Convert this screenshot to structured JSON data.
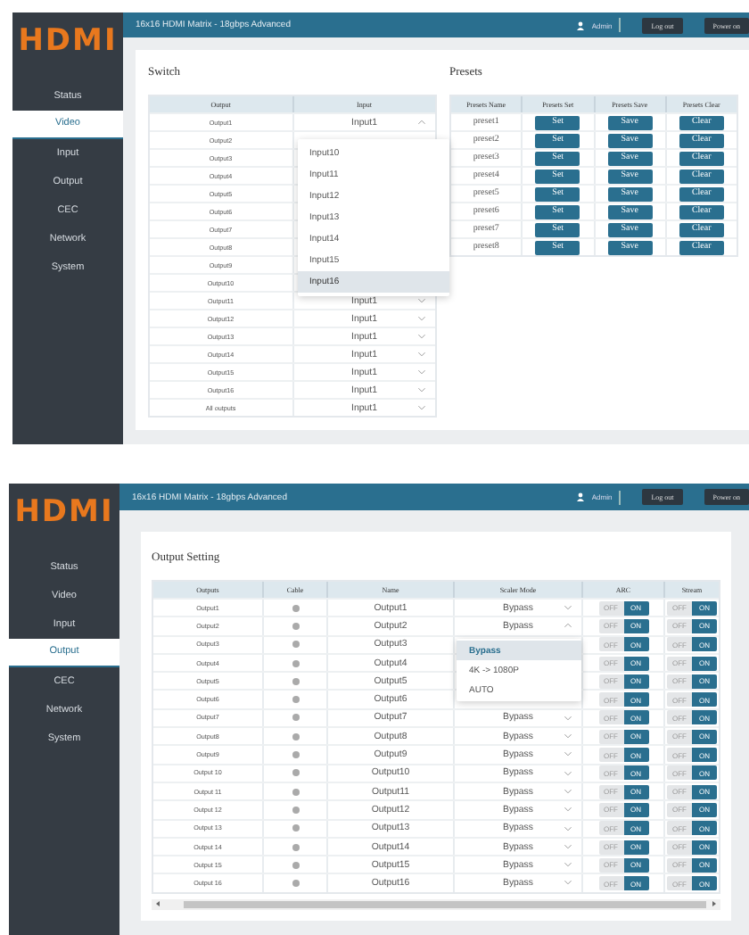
{
  "screens": [
    {
      "kind": "switch",
      "logo": "HDMI",
      "header": {
        "title": "16x16 HDMI Matrix - 18gbps Advanced",
        "user": "Admin",
        "logout": "Log out",
        "power": "Power on"
      },
      "nav": [
        {
          "label": "Status",
          "selected": false
        },
        {
          "label": "Video",
          "selected": true
        },
        {
          "label": "Input",
          "selected": false
        },
        {
          "label": "Output",
          "selected": false
        },
        {
          "label": "CEC",
          "selected": false
        },
        {
          "label": "Network",
          "selected": false
        },
        {
          "label": "System",
          "selected": false
        }
      ],
      "switch": {
        "title": "Switch",
        "columns": [
          "Output",
          "Input"
        ],
        "rows": [
          {
            "output": "Output1",
            "input": "Input1",
            "open": true
          },
          {
            "output": "Output2"
          },
          {
            "output": "Output3"
          },
          {
            "output": "Output4"
          },
          {
            "output": "Output5"
          },
          {
            "output": "Output6"
          },
          {
            "output": "Output7"
          },
          {
            "output": "Output8"
          },
          {
            "output": "Output9"
          },
          {
            "output": "Output10"
          },
          {
            "output": "Output11",
            "input": "Input1",
            "open": false
          },
          {
            "output": "Output12",
            "input": "Input1",
            "open": false
          },
          {
            "output": "Output13",
            "input": "Input1",
            "open": false
          },
          {
            "output": "Output14",
            "input": "Input1",
            "open": false
          },
          {
            "output": "Output15",
            "input": "Input1",
            "open": false
          },
          {
            "output": "Output16",
            "input": "Input1",
            "open": false
          },
          {
            "output": "All outputs",
            "input": "Input1",
            "open": false
          }
        ],
        "options": [
          {
            "label": "Input10",
            "selected": false
          },
          {
            "label": "Input11",
            "selected": false
          },
          {
            "label": "Input12",
            "selected": false
          },
          {
            "label": "Input13",
            "selected": false
          },
          {
            "label": "Input14",
            "selected": false
          },
          {
            "label": "Input15",
            "selected": false
          },
          {
            "label": "Input16",
            "selected": true
          }
        ]
      },
      "presets": {
        "title": "Presets",
        "columns": [
          "Presets Name",
          "Presets Set",
          "Presets Save",
          "Presets Clear"
        ],
        "rows": [
          {
            "name": "preset1",
            "set": "Set",
            "save": "Save",
            "clear": "Clear"
          },
          {
            "name": "preset2",
            "set": "Set",
            "save": "Save",
            "clear": "Clear"
          },
          {
            "name": "preset3",
            "set": "Set",
            "save": "Save",
            "clear": "Clear"
          },
          {
            "name": "preset4",
            "set": "Set",
            "save": "Save",
            "clear": "Clear"
          },
          {
            "name": "preset5",
            "set": "Set",
            "save": "Save",
            "clear": "Clear"
          },
          {
            "name": "preset6",
            "set": "Set",
            "save": "Save",
            "clear": "Clear"
          },
          {
            "name": "preset7",
            "set": "Set",
            "save": "Save",
            "clear": "Clear"
          },
          {
            "name": "preset8",
            "set": "Set",
            "save": "Save",
            "clear": "Clear"
          }
        ]
      }
    },
    {
      "kind": "output_setting",
      "logo": "HDMI",
      "header": {
        "title": "16x16 HDMI Matrix - 18gbps Advanced",
        "user": "Admin",
        "logout": "Log out",
        "power": "Power on"
      },
      "nav": [
        {
          "label": "Status",
          "selected": false
        },
        {
          "label": "Video",
          "selected": false
        },
        {
          "label": "Input",
          "selected": false
        },
        {
          "label": "Output",
          "selected": true
        },
        {
          "label": "CEC",
          "selected": false
        },
        {
          "label": "Network",
          "selected": false
        },
        {
          "label": "System",
          "selected": false
        }
      ],
      "output_setting": {
        "title": "Output Setting",
        "columns": [
          "Outputs",
          "Cable",
          "Name",
          "Scaler Mode",
          "ARC",
          "Stream"
        ],
        "rows": [
          {
            "output": "Output1",
            "name": "Output1",
            "mode": "Bypass",
            "open": false,
            "arc": {
              "labels": [
                "OFF",
                "ON"
              ],
              "on": true
            },
            "stream": {
              "labels": [
                "OFF",
                "ON"
              ],
              "on": true
            }
          },
          {
            "output": "Output2",
            "name": "Output2",
            "mode": "Bypass",
            "open": true,
            "arc": {
              "labels": [
                "OFF",
                "ON"
              ],
              "on": true
            },
            "stream": {
              "labels": [
                "OFF",
                "ON"
              ],
              "on": true
            }
          },
          {
            "output": "Output3",
            "name": "Output3",
            "arc": {
              "labels": [
                "OFF",
                "ON"
              ],
              "on": true
            },
            "stream": {
              "labels": [
                "OFF",
                "ON"
              ],
              "on": true
            }
          },
          {
            "output": "Output4",
            "name": "Output4",
            "arc": {
              "labels": [
                "OFF",
                "ON"
              ],
              "on": true
            },
            "stream": {
              "labels": [
                "OFF",
                "ON"
              ],
              "on": true
            }
          },
          {
            "output": "Output5",
            "name": "Output5",
            "arc": {
              "labels": [
                "OFF",
                "ON"
              ],
              "on": true
            },
            "stream": {
              "labels": [
                "OFF",
                "ON"
              ],
              "on": true
            }
          },
          {
            "output": "Output6",
            "name": "Output6",
            "arc": {
              "labels": [
                "OFF",
                "ON"
              ],
              "on": true
            },
            "stream": {
              "labels": [
                "OFF",
                "ON"
              ],
              "on": true
            }
          },
          {
            "output": "Output7",
            "name": "Output7",
            "mode": "Bypass",
            "open": false,
            "arc": {
              "labels": [
                "OFF",
                "ON"
              ],
              "on": true
            },
            "stream": {
              "labels": [
                "OFF",
                "ON"
              ],
              "on": true
            }
          },
          {
            "output": "Output8",
            "name": "Output8",
            "mode": "Bypass",
            "open": false,
            "arc": {
              "labels": [
                "OFF",
                "ON"
              ],
              "on": true
            },
            "stream": {
              "labels": [
                "OFF",
                "ON"
              ],
              "on": true
            }
          },
          {
            "output": "Output9",
            "name": "Output9",
            "mode": "Bypass",
            "open": false,
            "arc": {
              "labels": [
                "OFF",
                "ON"
              ],
              "on": true
            },
            "stream": {
              "labels": [
                "OFF",
                "ON"
              ],
              "on": true
            }
          },
          {
            "output": "Output 10",
            "name": "Output10",
            "mode": "Bypass",
            "open": false,
            "arc": {
              "labels": [
                "OFF",
                "ON"
              ],
              "on": true
            },
            "stream": {
              "labels": [
                "OFF",
                "ON"
              ],
              "on": true
            }
          },
          {
            "output": "Output 11",
            "name": "Output11",
            "mode": "Bypass",
            "open": false,
            "arc": {
              "labels": [
                "OFF",
                "ON"
              ],
              "on": true
            },
            "stream": {
              "labels": [
                "OFF",
                "ON"
              ],
              "on": true
            }
          },
          {
            "output": "Output 12",
            "name": "Output12",
            "mode": "Bypass",
            "open": false,
            "arc": {
              "labels": [
                "OFF",
                "ON"
              ],
              "on": true
            },
            "stream": {
              "labels": [
                "OFF",
                "ON"
              ],
              "on": true
            }
          },
          {
            "output": "Output 13",
            "name": "Output13",
            "mode": "Bypass",
            "open": false,
            "arc": {
              "labels": [
                "OFF",
                "ON"
              ],
              "on": true
            },
            "stream": {
              "labels": [
                "OFF",
                "ON"
              ],
              "on": true
            }
          },
          {
            "output": "Output 14",
            "name": "Output14",
            "mode": "Bypass",
            "open": false,
            "arc": {
              "labels": [
                "OFF",
                "ON"
              ],
              "on": true
            },
            "stream": {
              "labels": [
                "OFF",
                "ON"
              ],
              "on": true
            }
          },
          {
            "output": "Output 15",
            "name": "Output15",
            "mode": "Bypass",
            "open": false,
            "arc": {
              "labels": [
                "OFF",
                "ON"
              ],
              "on": true
            },
            "stream": {
              "labels": [
                "OFF",
                "ON"
              ],
              "on": true
            }
          },
          {
            "output": "Output 16",
            "name": "Output16",
            "mode": "Bypass",
            "open": false,
            "arc": {
              "labels": [
                "OFF",
                "ON"
              ],
              "on": true
            },
            "stream": {
              "labels": [
                "OFF",
                "ON"
              ],
              "on": true
            }
          }
        ],
        "options": [
          {
            "label": "Bypass",
            "selected": true
          },
          {
            "label": "4K -> 1080P",
            "selected": false
          },
          {
            "label": "AUTO",
            "selected": false
          }
        ]
      }
    }
  ]
}
